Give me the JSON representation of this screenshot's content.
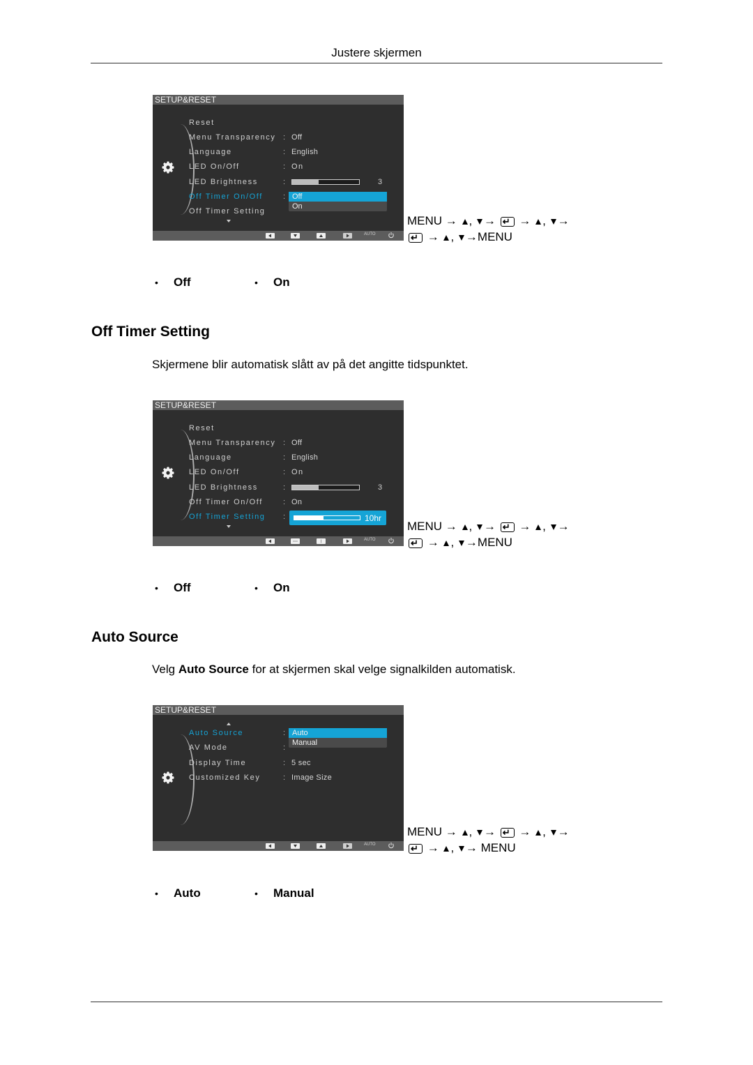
{
  "page_header": "Justere skjermen",
  "sections": [
    {
      "osd": {
        "title": "SETUP&RESET",
        "rows": [
          {
            "label": "Reset",
            "value": ""
          },
          {
            "label": "Menu Transparency",
            "value": "Off"
          },
          {
            "label": "Language",
            "value": "English"
          },
          {
            "label": "LED On/Off",
            "value": "On"
          },
          {
            "label": "LED Brightness",
            "value": "3",
            "bar_fraction": 0.4
          },
          {
            "label": "Off Timer On/Off",
            "value": "",
            "active": true
          },
          {
            "label": "Off Timer Setting",
            "value": ""
          }
        ],
        "dropdown": [
          "Off",
          "On"
        ],
        "dropdown_selected": "Off",
        "footer": {
          "auto_label": "AUTO"
        }
      },
      "nav": {
        "menu": "MENU",
        "end": "MENU"
      },
      "bullets": [
        "Off",
        "On"
      ]
    },
    {
      "title": "Off Timer Setting",
      "description": "Skjermene blir automatisk slått av på det angitte tidspunktet.",
      "osd": {
        "title": "SETUP&RESET",
        "rows": [
          {
            "label": "Reset",
            "value": ""
          },
          {
            "label": "Menu Transparency",
            "value": "Off"
          },
          {
            "label": "Language",
            "value": "English"
          },
          {
            "label": "LED On/Off",
            "value": "On"
          },
          {
            "label": "LED Brightness",
            "value": "3",
            "bar_fraction": 0.4
          },
          {
            "label": "Off Timer On/Off",
            "value": "On"
          },
          {
            "label": "Off Timer Setting",
            "value": "",
            "active": true
          }
        ],
        "timer_value": "10hr",
        "timer_fraction": 0.45,
        "footer": {
          "auto_label": "AUTO"
        }
      },
      "nav": {
        "menu": "MENU",
        "end": "MENU"
      },
      "bullets": [
        "Off",
        "On"
      ]
    },
    {
      "title": "Auto Source",
      "description_prefix": "Velg ",
      "description_bold": "Auto Source",
      "description_suffix": " for at skjermen skal velge signalkilden automatisk.",
      "osd": {
        "title": "SETUP&RESET",
        "rows": [
          {
            "label": "Auto Source",
            "value": "",
            "active": true
          },
          {
            "label": "AV Mode",
            "value": ""
          },
          {
            "label": "Display Time",
            "value": "5 sec"
          },
          {
            "label": "Customized Key",
            "value": "Image Size"
          }
        ],
        "dropdown": [
          "Auto",
          "Manual"
        ],
        "dropdown_selected": "Auto",
        "footer": {
          "auto_label": "AUTO"
        }
      },
      "nav": {
        "menu": "MENU",
        "end": "MENU"
      },
      "bullets": [
        "Auto",
        "Manual"
      ]
    }
  ]
}
